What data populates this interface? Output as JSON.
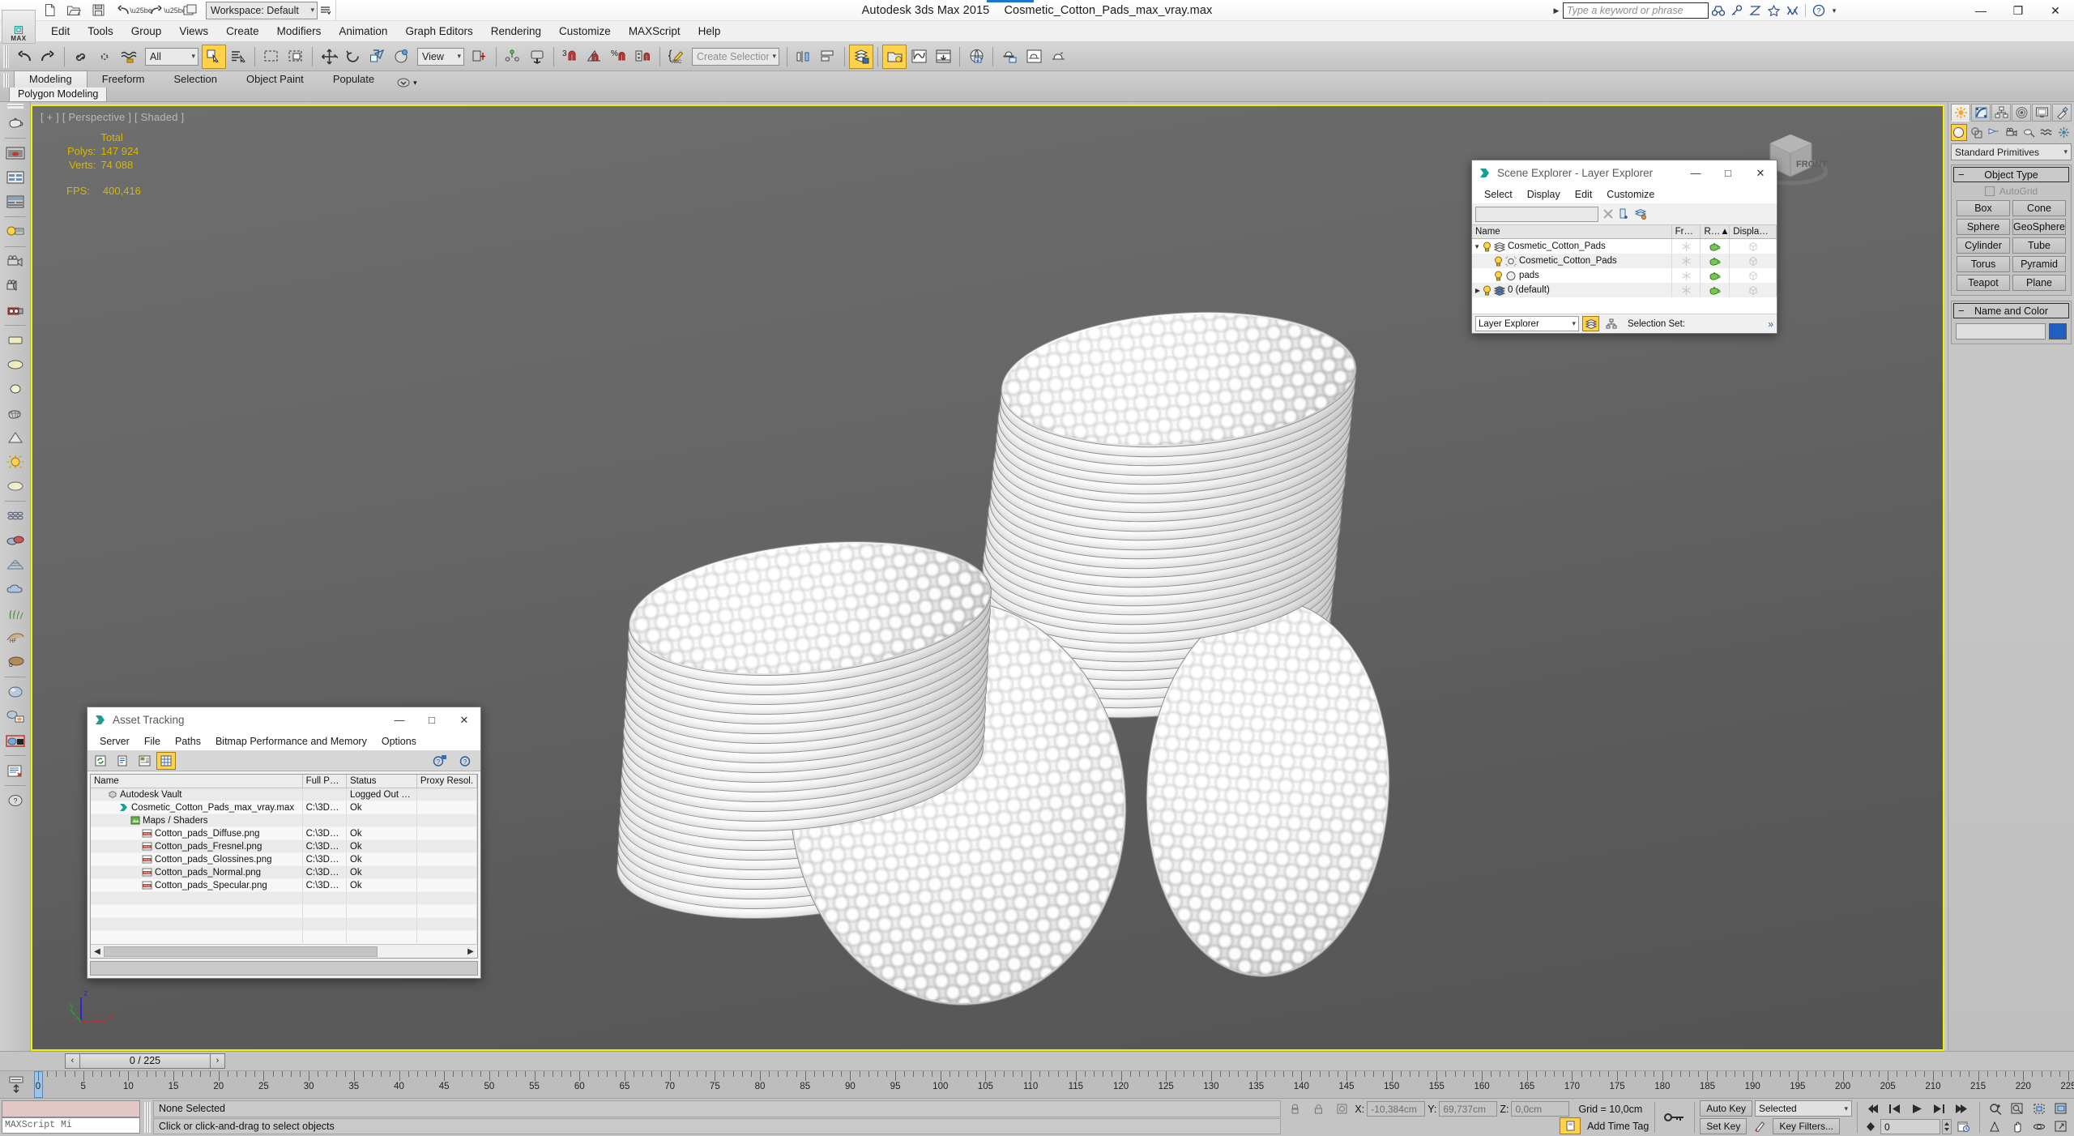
{
  "app": {
    "title_product": "Autodesk 3ds Max  2015",
    "title_file": "Cosmetic_Cotton_Pads_max_vray.max",
    "logo_text": "MAX"
  },
  "quick_access": {
    "workspace_label": "Workspace: Default",
    "buttons": [
      "new-file",
      "open-file",
      "save-file",
      "undo",
      "undo-dropdown",
      "redo",
      "redo-dropdown",
      "project-folder"
    ]
  },
  "search": {
    "placeholder": "Type a keyword or phrase",
    "icons": [
      "binoculars-icon",
      "key-icon",
      "subscription-icon",
      "star-icon",
      "exchange-icon",
      "help-icon"
    ]
  },
  "window_controls": {
    "minimize": "—",
    "maximize": "❐",
    "close": "✕"
  },
  "menu": {
    "items": [
      "Edit",
      "Tools",
      "Group",
      "Views",
      "Create",
      "Modifiers",
      "Animation",
      "Graph Editors",
      "Rendering",
      "Customize",
      "MAXScript",
      "Help"
    ]
  },
  "main_toolbar": {
    "selection_filter": "All",
    "reference_coord": "View",
    "named_selection_placeholder": "Create Selection Se",
    "active_buttons": [
      "select-object-button",
      "layer-explorer-button",
      "material-editor-button"
    ]
  },
  "ribbon": {
    "tabs": [
      "Modeling",
      "Freeform",
      "Selection",
      "Object Paint",
      "Populate"
    ],
    "active_tab": "Modeling",
    "panel_label": "Polygon Modeling"
  },
  "viewport": {
    "label": "[ + ] [ Perspective ] [ Shaded ]",
    "stats": {
      "column_header": "Total",
      "polys_label": "Polys:",
      "polys_value": "147 924",
      "verts_label": "Verts:",
      "verts_value": "74 088",
      "fps_label": "FPS:",
      "fps_value": "400,416"
    },
    "axis": {
      "x": "x",
      "y": "y",
      "z": "z"
    },
    "viewcube_face": "FRONT"
  },
  "command_panel": {
    "tabs": [
      "create-tab",
      "modify-tab",
      "hierarchy-tab",
      "motion-tab",
      "display-tab",
      "utilities-tab"
    ],
    "active_tab": "create-tab",
    "category_icons": [
      "geometry-icon",
      "shapes-icon",
      "lights-icon",
      "cameras-icon",
      "helpers-icon",
      "space-warps-icon",
      "systems-icon"
    ],
    "subcategory": "Standard Primitives",
    "object_type": {
      "title": "Object Type",
      "autogrid_label": "AutoGrid",
      "buttons": [
        "Box",
        "Cone",
        "Sphere",
        "GeoSphere",
        "Cylinder",
        "Tube",
        "Torus",
        "Pyramid",
        "Teapot",
        "Plane"
      ]
    },
    "name_and_color": {
      "title": "Name and Color",
      "name_value": "",
      "color": "#1f5fbf"
    }
  },
  "scene_explorer": {
    "title": "Scene Explorer - Layer Explorer",
    "menu": [
      "Select",
      "Display",
      "Edit",
      "Customize"
    ],
    "search_value": "",
    "columns": [
      "Name",
      "Fr…",
      "R…▲",
      "Displa…"
    ],
    "rows": [
      {
        "name": "Cosmetic_Cotton_Pads",
        "depth": 0,
        "expander": "▼",
        "icon": "layer-icon",
        "frozen": "❄",
        "render": "teapot-icon",
        "display": "box-icon"
      },
      {
        "name": "Cosmetic_Cotton_Pads",
        "depth": 1,
        "expander": "",
        "icon": "object-icon",
        "frozen": "❄",
        "render": "teapot-icon",
        "display": "box-icon"
      },
      {
        "name": "pads",
        "depth": 1,
        "expander": "",
        "icon": "sphere-icon",
        "frozen": "❄",
        "render": "teapot-icon",
        "display": "box-icon"
      },
      {
        "name": "0 (default)",
        "depth": 0,
        "expander": "▶",
        "icon": "layer-icon-blue",
        "frozen": "❄",
        "render": "teapot-icon",
        "display": "box-icon"
      }
    ],
    "footer": {
      "mode": "Layer Explorer",
      "selection_set_label": "Selection Set:",
      "overflow": "»"
    }
  },
  "asset_tracking": {
    "title": "Asset Tracking",
    "menu": [
      "Server",
      "File",
      "Paths",
      "Bitmap Performance and Memory",
      "Options"
    ],
    "toolbar_icons": [
      "refresh-icon",
      "list-view-icon",
      "thumbnail-view-icon",
      "grid-view-icon",
      "help-new-icon",
      "help-icon"
    ],
    "columns": [
      "Name",
      "Full P…",
      "Status",
      "Proxy Resol."
    ],
    "rows": [
      {
        "name": "Autodesk Vault",
        "depth": 0,
        "icon": "vault-icon",
        "path": "",
        "status": "Logged Out …"
      },
      {
        "name": "Cosmetic_Cotton_Pads_max_vray.max",
        "depth": 1,
        "icon": "max-file-icon",
        "path": "C:\\3D…",
        "status": "Ok"
      },
      {
        "name": "Maps / Shaders",
        "depth": 2,
        "icon": "maps-icon",
        "path": "",
        "status": ""
      },
      {
        "name": "Cotton_pads_Diffuse.png",
        "depth": 3,
        "icon": "png-icon",
        "path": "C:\\3D…",
        "status": "Ok"
      },
      {
        "name": "Cotton_pads_Fresnel.png",
        "depth": 3,
        "icon": "png-icon",
        "path": "C:\\3D…",
        "status": "Ok"
      },
      {
        "name": "Cotton_pads_Glossines.png",
        "depth": 3,
        "icon": "png-icon",
        "path": "C:\\3D…",
        "status": "Ok"
      },
      {
        "name": "Cotton_pads_Normal.png",
        "depth": 3,
        "icon": "png-icon",
        "path": "C:\\3D…",
        "status": "Ok"
      },
      {
        "name": "Cotton_pads_Specular.png",
        "depth": 3,
        "icon": "png-icon",
        "path": "C:\\3D…",
        "status": "Ok"
      }
    ]
  },
  "time_slider": {
    "value": "0 / 225",
    "prev": "‹",
    "next": "›"
  },
  "track_bar": {
    "tick_start": 0,
    "tick_end": 225,
    "tick_step": 5,
    "labels": [
      0,
      5,
      10,
      15,
      20,
      25,
      30,
      35,
      40,
      45,
      50,
      55,
      60,
      65,
      70,
      75,
      80,
      85,
      90,
      95,
      100,
      105,
      110,
      115,
      120,
      125,
      130,
      135,
      140,
      145,
      150,
      155,
      160,
      165,
      170,
      175,
      180,
      185,
      190,
      195,
      200,
      205,
      210,
      215,
      220,
      225
    ],
    "playhead_frame": 0
  },
  "status_bar": {
    "selection_status": "None Selected",
    "prompt": "Click or click-and-drag to select objects",
    "maxscript_label": "MAXScript Mi",
    "coords": {
      "x_label": "X:",
      "x_value": "-10,384cm",
      "y_label": "Y:",
      "y_value": "69,737cm",
      "z_label": "Z:",
      "z_value": "0,0cm"
    },
    "grid_label": "Grid = 10,0cm",
    "add_time_tag": "Add Time Tag",
    "auto_key": "Auto Key",
    "set_key": "Set Key",
    "key_filters": "Key Filters...",
    "key_mode_selected": "Selected",
    "spinner_value": "0",
    "playback_icons": [
      "go-to-start",
      "previous-frame",
      "play",
      "next-frame",
      "go-to-end"
    ],
    "nav_icons": [
      "zoom-icon",
      "zoom-all-icon",
      "zoom-extents-icon",
      "zoom-region-icon",
      "pan-icon",
      "orbit-icon",
      "maximize-viewport-icon"
    ]
  }
}
